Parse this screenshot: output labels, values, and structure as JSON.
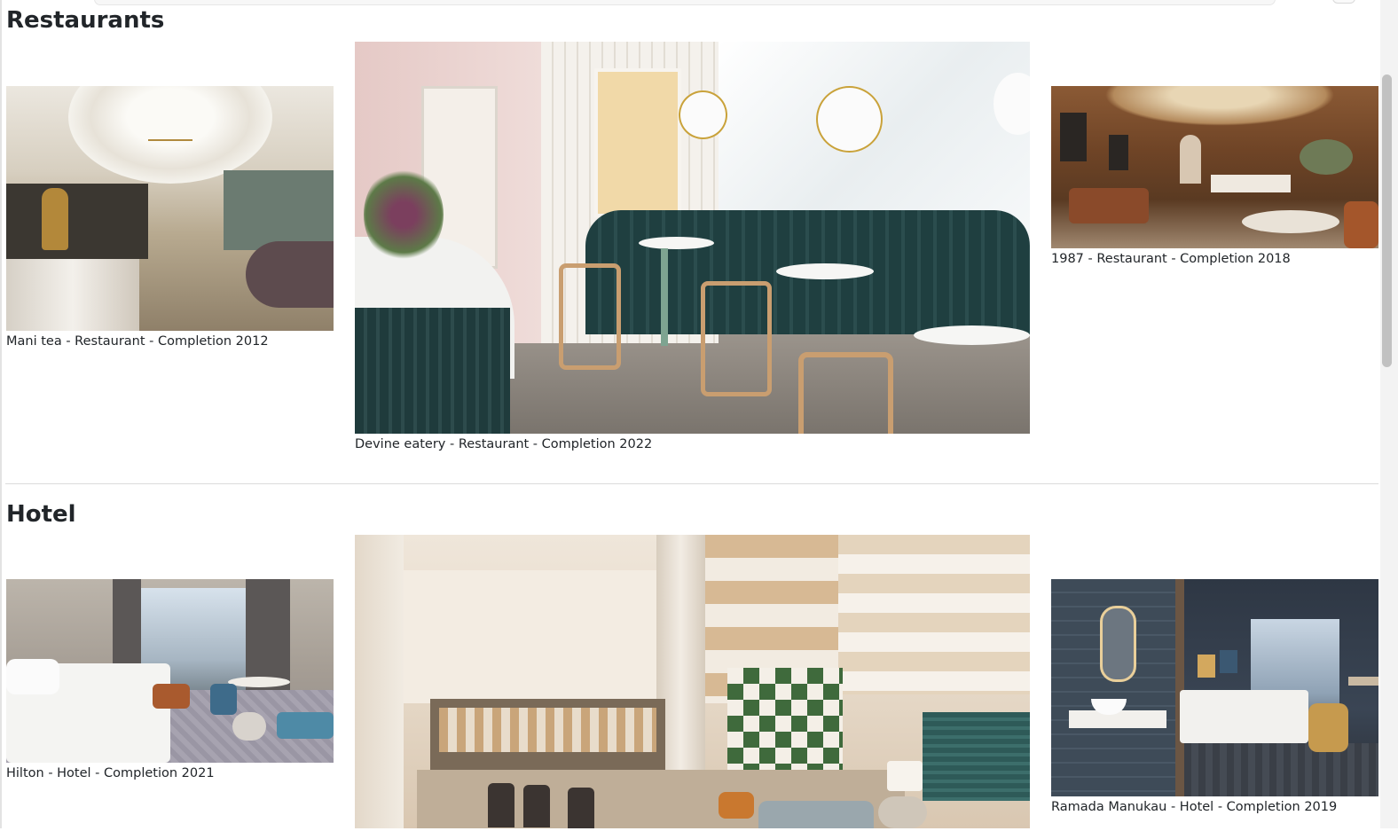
{
  "sections": [
    {
      "heading": "Restaurants",
      "items": [
        {
          "caption": "Mani tea - Restaurant - Completion 2012"
        },
        {
          "caption": "Devine eatery - Restaurant - Completion 2022"
        },
        {
          "caption": "1987 - Restaurant - Completion 2018"
        }
      ]
    },
    {
      "heading": "Hotel",
      "items": [
        {
          "caption": "Hilton - Hotel - Completion 2021"
        },
        {
          "caption": ""
        },
        {
          "caption": "Ramada Manukau - Hotel - Completion 2019"
        }
      ]
    }
  ],
  "colors": {
    "text": "#212529",
    "divider": "#dcdcdc",
    "scrollbar_thumb": "#c1c1c1"
  }
}
